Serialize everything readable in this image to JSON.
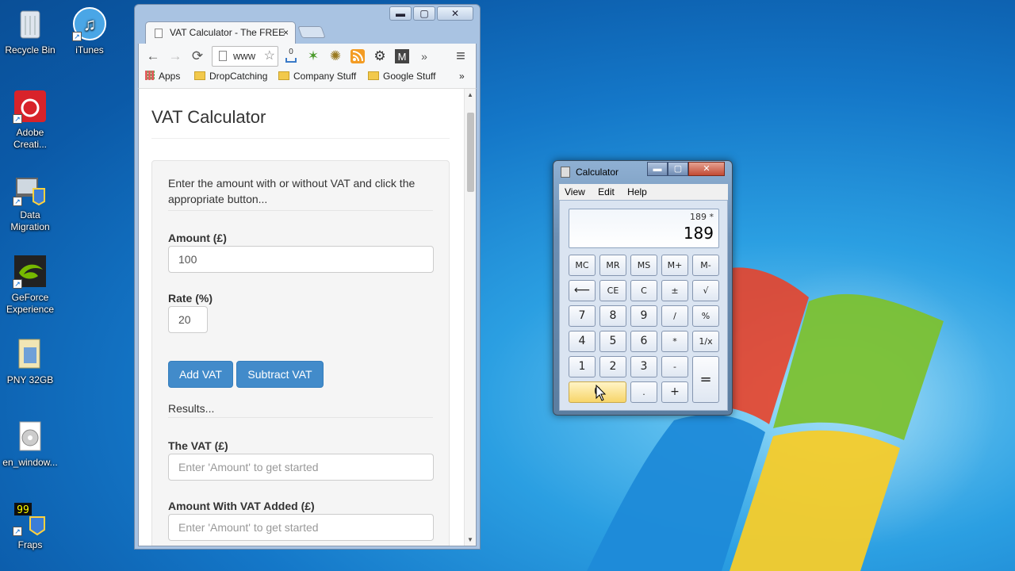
{
  "desktop": {
    "icons": [
      {
        "label": "Recycle Bin"
      },
      {
        "label": "iTunes"
      },
      {
        "label": "Adobe Creati..."
      },
      {
        "label": "Data Migration"
      },
      {
        "label": "GeForce Experience"
      },
      {
        "label": "PNY 32GB"
      },
      {
        "label": "en_window..."
      },
      {
        "label": "Fraps"
      }
    ]
  },
  "browser": {
    "window_buttons": {
      "minimize": "▬",
      "maximize": "▢",
      "close": "✕"
    },
    "tab": {
      "title": "VAT Calculator - The FREE",
      "close": "×"
    },
    "nav": {
      "back": "←",
      "forward": "→",
      "reload": "⟳",
      "more": "»",
      "menu": "≡"
    },
    "omnibox": {
      "value": "www"
    },
    "extension_badge": "0",
    "bookmarks": {
      "apps": "Apps",
      "items": [
        "DropCatching",
        "Company Stuff",
        "Google Stuff"
      ],
      "more": "»"
    },
    "page": {
      "title": "VAT Calculator",
      "intro": "Enter the amount with or without VAT and click the appropriate button...",
      "amount_label": "Amount (£)",
      "amount_value": "100",
      "rate_label": "Rate (%)",
      "rate_value": "20",
      "add_vat": "Add VAT",
      "subtract_vat": "Subtract VAT",
      "results": "Results...",
      "vat_label": "The VAT (£)",
      "vat_placeholder": "Enter 'Amount' to get started",
      "with_vat_label": "Amount With VAT Added (£)",
      "with_vat_placeholder": "Enter 'Amount' to get started"
    }
  },
  "calculator": {
    "title": "Calculator",
    "menu": [
      "View",
      "Edit",
      "Help"
    ],
    "display_expression": "189  *",
    "display_value": "189",
    "keys": {
      "mc": "MC",
      "mr": "MR",
      "ms": "MS",
      "mplus": "M+",
      "mminus": "M-",
      "back": "⟵",
      "ce": "CE",
      "c": "C",
      "pm": "±",
      "sqrt": "√",
      "k7": "7",
      "k8": "8",
      "k9": "9",
      "div": "/",
      "pct": "%",
      "k4": "4",
      "k5": "5",
      "k6": "6",
      "mul": "*",
      "inv": "1/x",
      "k1": "1",
      "k2": "2",
      "k3": "3",
      "sub": "-",
      "eq": "=",
      "k0": "0",
      "dot": ".",
      "add": "+"
    }
  }
}
